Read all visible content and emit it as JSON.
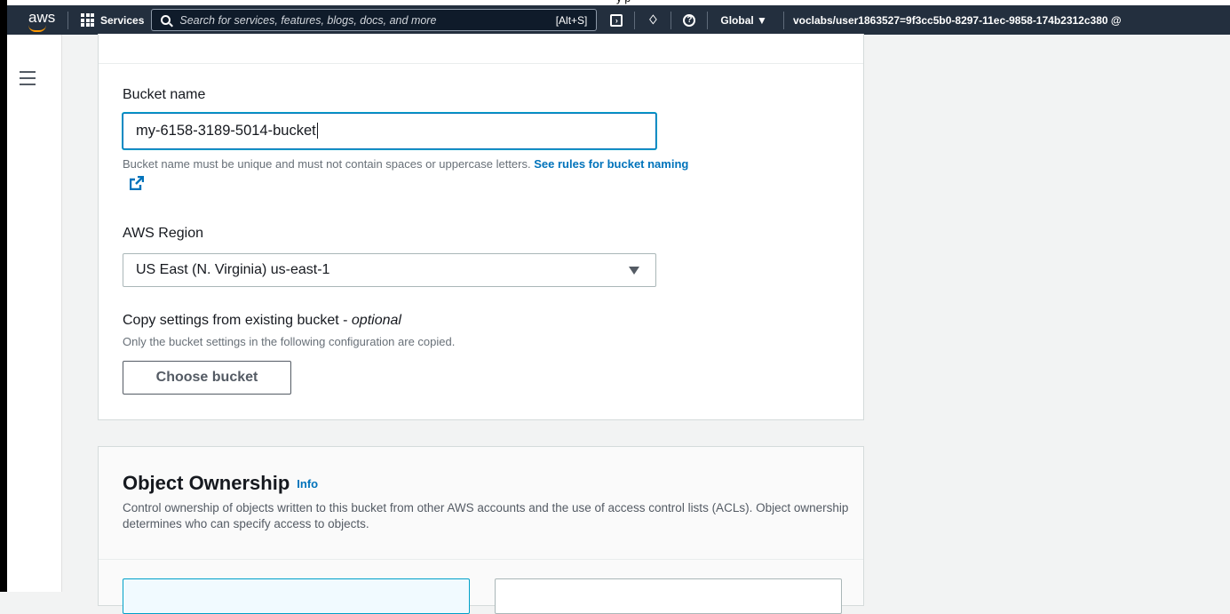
{
  "top_strip": {
    "text": "y p"
  },
  "nav": {
    "logo_text": "aws",
    "services_label": "Services",
    "search_placeholder": "Search for services, features, blogs, docs, and more",
    "search_shortcut": "[Alt+S]",
    "region_label": "Global ▼",
    "account_label": "voclabs/user1863527=9f3cc5b0-8297-11ec-9858-174b2312c380 @"
  },
  "bucket": {
    "name_label": "Bucket name",
    "name_value": "my-6158-3189-5014-bucket",
    "name_hint": "Bucket name must be unique and must not contain spaces or uppercase letters.",
    "name_rules_link": "See rules for bucket naming",
    "region_label": "AWS Region",
    "region_value": "US East (N. Virginia) us-east-1",
    "copy_label": "Copy settings from existing bucket - ",
    "copy_label_optional": "optional",
    "copy_hint": "Only the bucket settings in the following configuration are copied.",
    "choose_button": "Choose bucket"
  },
  "object_ownership": {
    "title": "Object Ownership",
    "info_link": "Info",
    "description": "Control ownership of objects written to this bucket from other AWS accounts and the use of access control lists (ACLs). Object ownership determines who can specify access to objects."
  },
  "colors": {
    "nav_bg": "#232f3e",
    "accent_orange": "#ff9900",
    "link_blue": "#0073bb",
    "focus_cyan": "#00a1c9"
  }
}
